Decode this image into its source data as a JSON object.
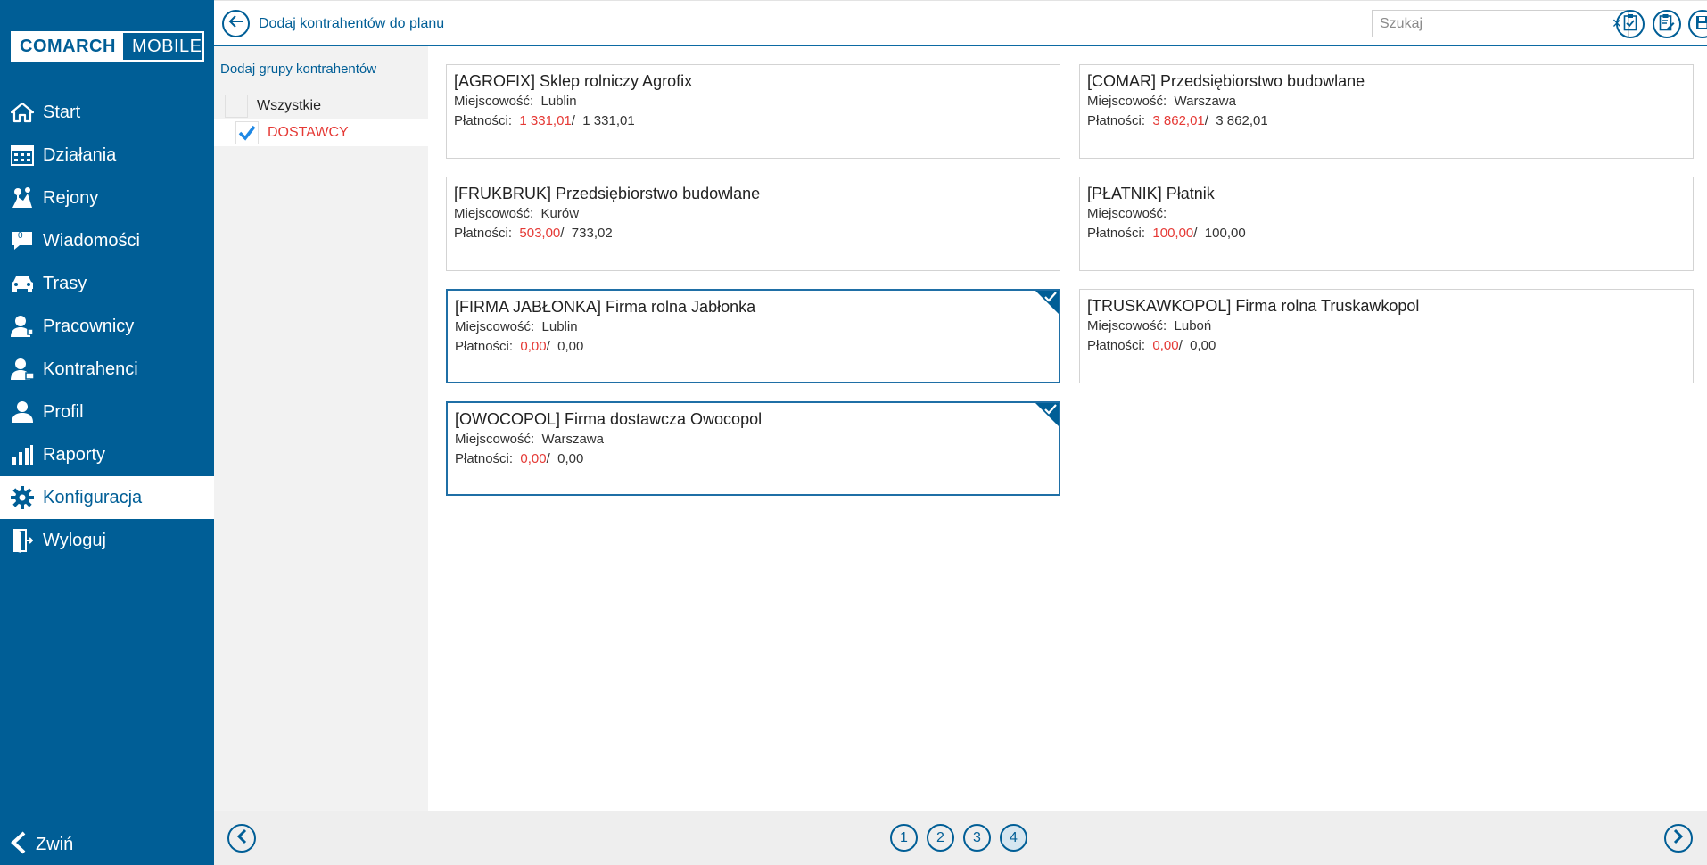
{
  "app": {
    "logo_left": "COMARCH",
    "logo_right": "MOBILE"
  },
  "sidebar": {
    "items": [
      {
        "label": "Start",
        "icon": "home-icon"
      },
      {
        "label": "Działania",
        "icon": "calendar-icon"
      },
      {
        "label": "Rejony",
        "icon": "map-icon"
      },
      {
        "label": "Wiadomości",
        "icon": "message-icon",
        "badge": "0"
      },
      {
        "label": "Trasy",
        "icon": "car-icon"
      },
      {
        "label": "Pracownicy",
        "icon": "employees-icon"
      },
      {
        "label": "Kontrahenci",
        "icon": "contractors-icon"
      },
      {
        "label": "Profil",
        "icon": "user-icon"
      },
      {
        "label": "Raporty",
        "icon": "chart-icon"
      },
      {
        "label": "Konfiguracja",
        "icon": "gear-icon",
        "active": true
      },
      {
        "label": "Wyloguj",
        "icon": "logout-icon"
      }
    ],
    "collapse_label": "Zwiń"
  },
  "topbar": {
    "title": "Dodaj kontrahentów do planu",
    "search_placeholder": "Szukaj",
    "clear_symbol": "×"
  },
  "groups": {
    "title": "Dodaj grupy kontrahentów",
    "items": [
      {
        "label": "Wszystkie",
        "checked": false
      },
      {
        "label": "DOSTAWCY",
        "checked": true
      }
    ]
  },
  "contractors": [
    {
      "title": "[AGROFIX] Sklep rolniczy Agrofix",
      "city_label": "Miejscowość:",
      "city": "Lublin",
      "pay_label": "Płatności:",
      "pay_due": "1 331,01",
      "pay_sep": "/",
      "pay_total": "1 331,01",
      "selected": false
    },
    {
      "title": "[COMAR] Przedsiębiorstwo budowlane",
      "city_label": "Miejscowość:",
      "city": "Warszawa",
      "pay_label": "Płatności:",
      "pay_due": "3 862,01",
      "pay_sep": "/",
      "pay_total": "3 862,01",
      "selected": false
    },
    {
      "title": "[FRUKBRUK] Przedsiębiorstwo budowlane",
      "city_label": "Miejscowość:",
      "city": "Kurów",
      "pay_label": "Płatności:",
      "pay_due": "503,00",
      "pay_sep": "/",
      "pay_total": "733,02",
      "selected": false
    },
    {
      "title": "[PŁATNIK] Płatnik",
      "city_label": "Miejscowość:",
      "city": "",
      "pay_label": "Płatności:",
      "pay_due": "100,00",
      "pay_sep": "/",
      "pay_total": "100,00",
      "selected": false
    },
    {
      "title": "[FIRMA JABŁONKA] Firma rolna Jabłonka",
      "city_label": "Miejscowość:",
      "city": "Lublin",
      "pay_label": "Płatności:",
      "pay_due": "0,00",
      "pay_sep": "/",
      "pay_total": "0,00",
      "selected": true
    },
    {
      "title": "[TRUSKAWKOPOL] Firma rolna Truskawkopol",
      "city_label": "Miejscowość:",
      "city": "Luboń",
      "pay_label": "Płatności:",
      "pay_due": "0,00",
      "pay_sep": "/",
      "pay_total": "0,00",
      "selected": false
    },
    {
      "title": "[OWOCOPOL] Firma dostawcza Owocopol",
      "city_label": "Miejscowość:",
      "city": "Warszawa",
      "pay_label": "Płatności:",
      "pay_due": "0,00",
      "pay_sep": "/",
      "pay_total": "0,00",
      "selected": true
    }
  ],
  "pagination": {
    "pages": [
      "1",
      "2",
      "3",
      "4"
    ],
    "current": "4"
  },
  "colors": {
    "brand": "#005e96",
    "accent_red": "#e53935"
  }
}
